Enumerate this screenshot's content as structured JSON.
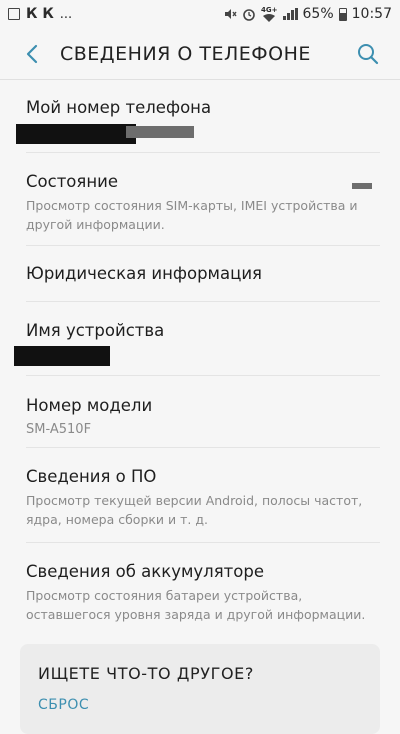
{
  "status_bar": {
    "carrier_letters": "К К",
    "dots": "...",
    "network": "4G+",
    "battery_percent": "65%",
    "time": "10:57",
    "icons": [
      "image-icon",
      "mute-icon",
      "alarm-icon",
      "wifi-icon",
      "signal-icon",
      "battery-icon"
    ]
  },
  "header": {
    "title": "СВЕДЕНИЯ О ТЕЛЕФОНЕ",
    "back_icon": "chevron-left-icon",
    "search_icon": "search-icon"
  },
  "items": [
    {
      "title": "Мой номер телефона"
    },
    {
      "title": "Состояние",
      "subtitle": "Просмотр состояния SIM-карты, IMEI устройства и другой информации."
    },
    {
      "title": "Юридическая информация"
    },
    {
      "title": "Имя устройства"
    },
    {
      "title": "Номер модели",
      "value": "SM-A510F"
    },
    {
      "title": "Сведения о ПО",
      "subtitle": "Просмотр текущей версии Android, полосы частот, ядра, номера сборки и т. д."
    },
    {
      "title": "Сведения об аккумуляторе",
      "subtitle": "Просмотр состояния батареи устройства, оставшегося уровня заряда и другой информации."
    }
  ],
  "suggestion_card": {
    "title": "ИЩЕТЕ ЧТО-ТО ДРУГОЕ?",
    "link": "СБРОС"
  },
  "colors": {
    "background": "#f6f6f6",
    "accent": "#3d8fb0",
    "secondary_text": "#8a8a8a"
  }
}
